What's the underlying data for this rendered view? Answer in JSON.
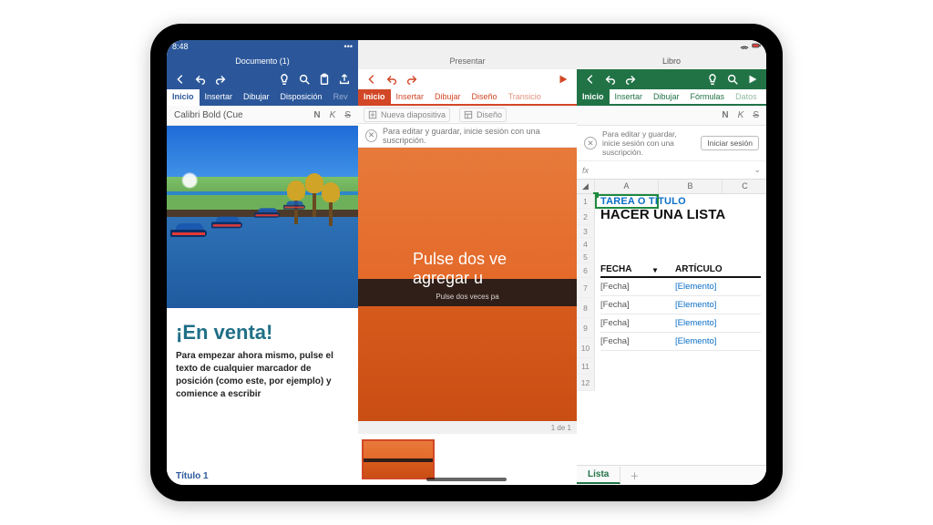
{
  "status": {
    "time": "8:48"
  },
  "word": {
    "title": "Documento (1)",
    "tabs": [
      "Inicio",
      "Insertar",
      "Dibujar",
      "Disposición",
      "Rev"
    ],
    "active_tab": 0,
    "font_input": "Calibri Bold (Cue",
    "bold": "N",
    "italic": "K",
    "strike": "S",
    "headline": "¡En venta!",
    "paragraph": "Para empezar ahora mismo, pulse el texto de cualquier marcador de posición (como este, por ejemplo) y comience a escribir",
    "footer_style": "Título 1"
  },
  "ppt": {
    "title": "Presentar",
    "tabs": [
      "Inicio",
      "Insertar",
      "Dibujar",
      "Diseño",
      "Transicio"
    ],
    "active_tab": 0,
    "sub_new": "Nueva diapositiva",
    "sub_design": "Diseño",
    "banner": "Para editar y guardar, inicie sesión con una suscripción.",
    "slide_title_l1": "Pulse dos ve",
    "slide_title_l2": "agregar u",
    "slide_sub": "Pulse dos veces pa",
    "page_of": "1 de 1"
  },
  "excel": {
    "title": "Libro",
    "tabs": [
      "Inicio",
      "Insertar",
      "Dibujar",
      "Fórmulas",
      "Datos"
    ],
    "active_tab": 0,
    "bold": "N",
    "italic": "K",
    "strike": "S",
    "banner": "Para editar y guardar, inicie sesión con una suscripción.",
    "signin": "Iniciar sesión",
    "fx_label": "fx",
    "cols": [
      "A",
      "B",
      "C"
    ],
    "row_numbers": [
      1,
      2,
      3,
      4,
      5,
      6,
      7,
      8,
      9,
      10,
      11,
      12
    ],
    "tag": "TAREA O TÍTULO",
    "title_text": "HACER UNA LISTA",
    "col_headers": [
      "FECHA",
      "ARTÍCULO"
    ],
    "rows": [
      {
        "fecha": "[Fecha]",
        "art": "[Elemento]"
      },
      {
        "fecha": "[Fecha]",
        "art": "[Elemento]"
      },
      {
        "fecha": "[Fecha]",
        "art": "[Elemento]"
      },
      {
        "fecha": "[Fecha]",
        "art": "[Elemento]"
      }
    ],
    "sheet_tab": "Lista"
  }
}
